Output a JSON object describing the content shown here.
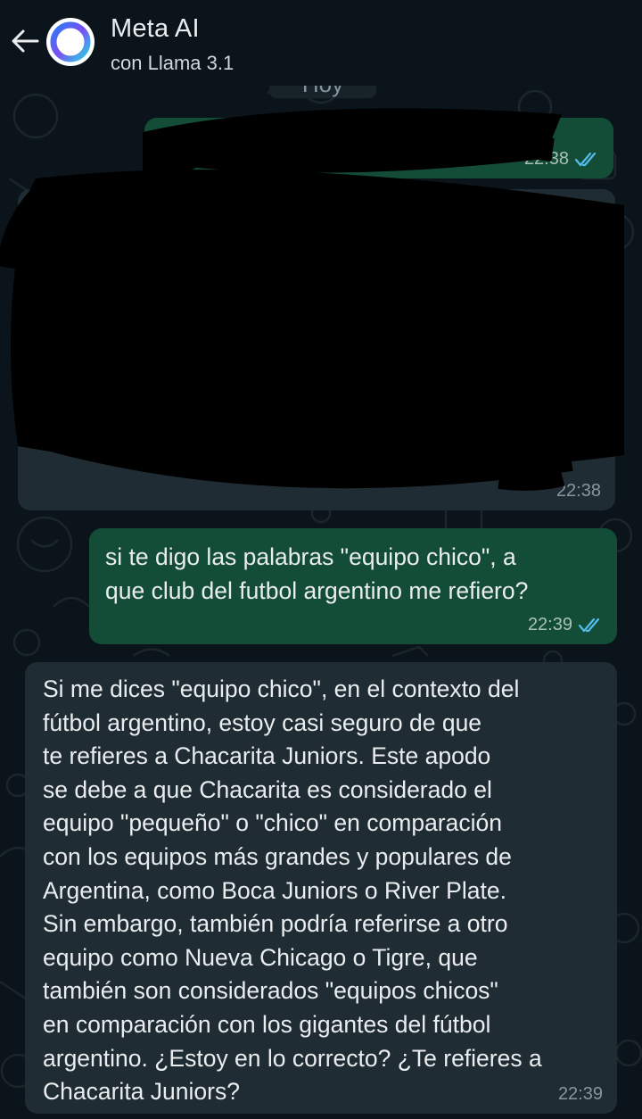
{
  "header": {
    "title": "Meta AI",
    "subtitle": "con Llama 3.1"
  },
  "date_separator": "Hoy",
  "messages": [
    {
      "direction": "outgoing",
      "text": "",
      "time": "22:38",
      "status": "read",
      "redacted": true
    },
    {
      "direction": "incoming",
      "text": "",
      "time": "22:38",
      "redacted": true
    },
    {
      "direction": "outgoing",
      "text": "si te digo las palabras \"equipo chico\", a\nque club del futbol argentino me refiero?",
      "time": "22:39",
      "status": "read"
    },
    {
      "direction": "incoming",
      "text": "Si me dices \"equipo chico\", en el contexto del\nfútbol argentino, estoy casi seguro de que\nte refieres a Chacarita Juniors. Este apodo\nse debe a que Chacarita es considerado el\nequipo \"pequeño\" o \"chico\" en comparación\ncon los equipos más grandes y populares de\nArgentina, como Boca Juniors o River Plate.\nSin embargo, también podría referirse a otro\nequipo como Nueva Chicago o Tigre, que\ntambién son considerados \"equipos chicos\"\nen comparación con los gigantes del fútbol\nargentino. ¿Estoy en lo correcto? ¿Te refieres a\nChacarita Juniors?",
      "time": "22:39"
    }
  ],
  "colors": {
    "background": "#0b141a",
    "outgoing_bubble": "#144d37",
    "incoming_bubble": "#202c33",
    "read_ticks": "#53bdeb",
    "text": "#e9edef"
  },
  "icons": [
    "back-arrow-icon",
    "meta-ai-ring-icon",
    "double-check-icon"
  ]
}
